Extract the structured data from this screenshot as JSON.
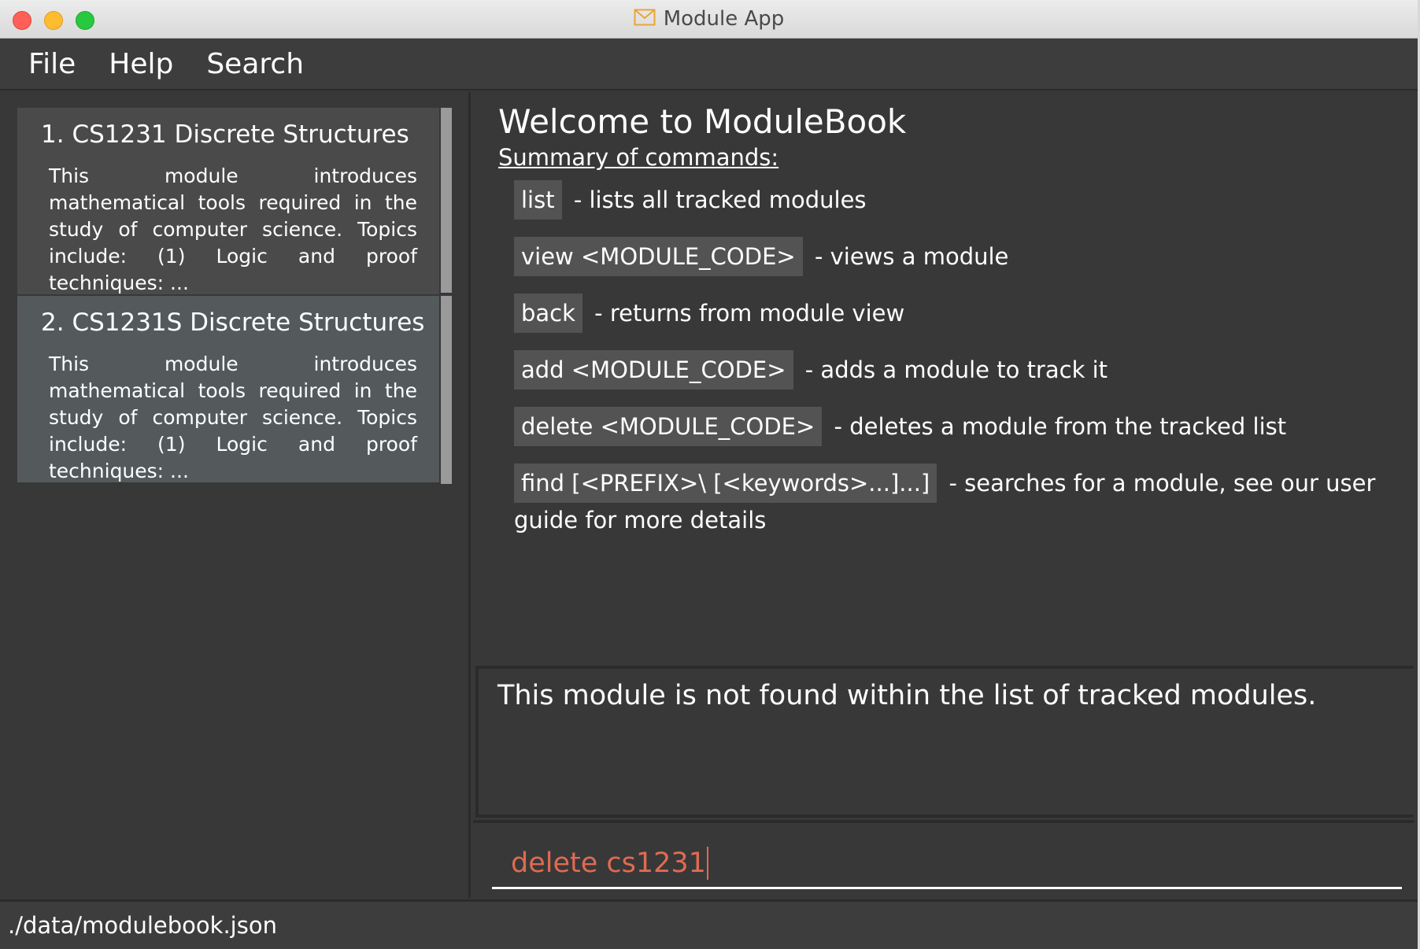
{
  "window": {
    "title": "Module App",
    "icon": "envelope-icon"
  },
  "menu": {
    "items": [
      "File",
      "Help",
      "Search"
    ]
  },
  "module_list": {
    "items": [
      {
        "index": "1.",
        "title": "CS1231 Discrete Structures",
        "description": "This module introduces mathematical tools required in the study of computer science. Topics include: (1) Logic and proof techniques: ..."
      },
      {
        "index": "2.",
        "title": "CS1231S Discrete Structures",
        "description": "This module introduces mathematical tools required in the study of computer science. Topics include: (1) Logic and proof techniques: ..."
      }
    ]
  },
  "help": {
    "welcome": "Welcome to ModuleBook",
    "summary_heading": "Summary of commands:",
    "commands": [
      {
        "code": "list",
        "desc": "- lists all tracked modules"
      },
      {
        "code": "view <MODULE_CODE>",
        "desc": "- views a module"
      },
      {
        "code": "back",
        "desc": "- returns from module view"
      },
      {
        "code": "add <MODULE_CODE>",
        "desc": "- adds a module to track it"
      },
      {
        "code": "delete <MODULE_CODE>",
        "desc": "- deletes a module from the tracked list"
      },
      {
        "code": "find [<PREFIX>\\ [<keywords>...]...]",
        "desc": "- searches for a module, see our user guide for more details"
      }
    ]
  },
  "result": {
    "message": "This module is not found within the list of tracked modules."
  },
  "command_box": {
    "value": "delete cs1231"
  },
  "status_bar": {
    "path": "./data/modulebook.json"
  },
  "colors": {
    "background": "#383838",
    "card": "#4a4a4a",
    "card_selected": "#545a5c",
    "command_text": "#e06a52"
  }
}
